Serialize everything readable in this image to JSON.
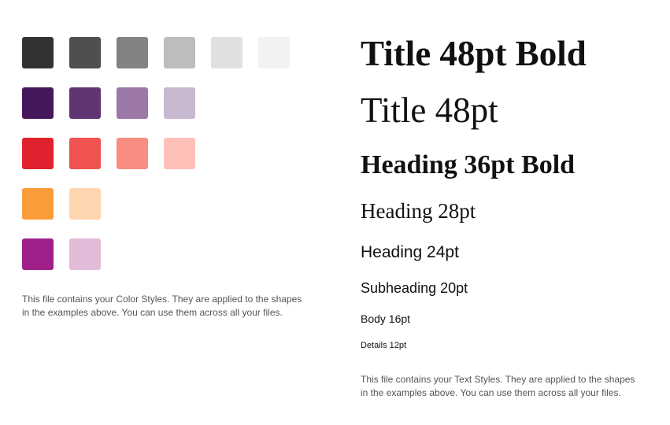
{
  "color_styles": {
    "rows": [
      [
        "#333333",
        "#4f4f4f",
        "#828282",
        "#bdbdbd",
        "#e0e0e0",
        "#f2f2f2"
      ],
      [
        "#47175c",
        "#613573",
        "#9b78a8",
        "#c8b8d0"
      ],
      [
        "#e0222e",
        "#ef5350",
        "#f98d82",
        "#ffc0b7"
      ],
      [
        "#fb9c3b",
        "#ffd5b0"
      ],
      [
        "#a0208a",
        "#e2bbd8"
      ]
    ],
    "description": "This file contains your Color Styles. They are applied to the shapes in the examples above. You can use them across all your files."
  },
  "text_styles": {
    "title_bold": "Title 48pt Bold",
    "title": "Title 48pt",
    "heading_36_bold": "Heading 36pt Bold",
    "heading_28": "Heading 28pt",
    "heading_24": "Heading 24pt",
    "subheading_20": "Subheading 20pt",
    "body_16": "Body 16pt",
    "details_12": "Details 12pt",
    "description": "This file contains your Text Styles. They are applied to the shapes in the examples above. You can use them across all your files."
  }
}
